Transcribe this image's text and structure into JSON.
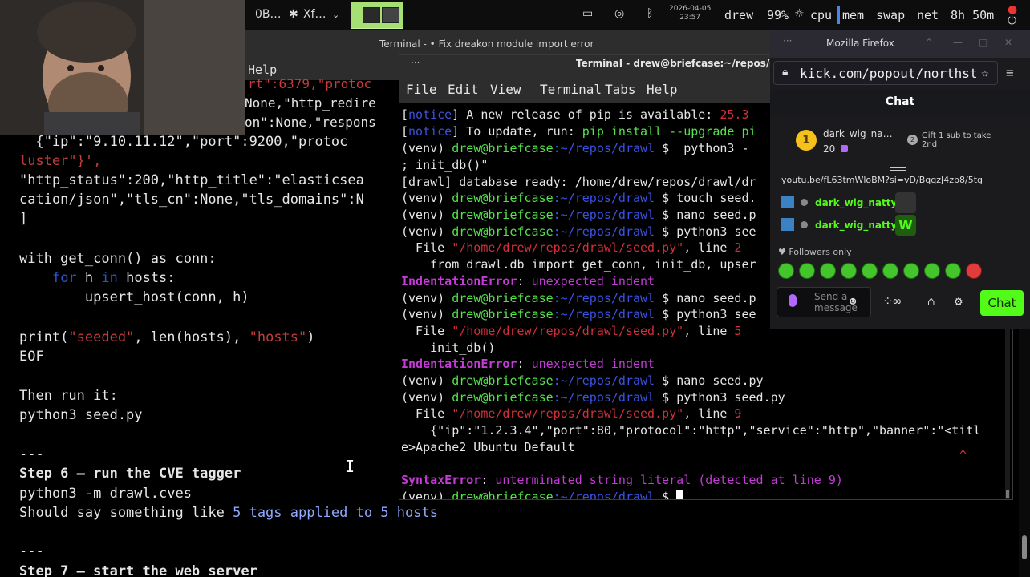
{
  "top_panel": {
    "ws1": "0B…",
    "ws2": "Xf…",
    "clock_date": "2026-04-05",
    "clock_time": "23:57",
    "user": "drew",
    "battery": "99%",
    "cpu": "cpu",
    "mem": "mem",
    "swap": "swap",
    "net": "net",
    "uptime": "8h 50m"
  },
  "bg_terminal": {
    "title": "Terminal - • Fix dreakon module import error",
    "menu_help": "Help"
  },
  "left_text": {
    "l1a": "rt\":6379,\"protoc",
    "l1b": "None,\"http_redire",
    "l2": "on\":None,\"respons",
    "l3a": "  {\"ip\":\"9.10.11.12\",\"port\":9200,\"protoc",
    "l4": "luster\"}',",
    "l5a": "\"http_status\":200,\"http_title\":\"elasticsea",
    "l6a": "cation/json\",\"tls_cn\":None,\"tls_domains\":N",
    "l7": "]",
    "l8": "with get_conn() as conn:",
    "l9a": "    ",
    "l9b": "for",
    "l9c": " h ",
    "l9d": "in",
    "l9e": " hosts:",
    "l10": "        upsert_host(conn, h)",
    "l11a": "print(",
    "l11b": "\"seeded\"",
    "l11c": ", len(hosts), ",
    "l11d": "\"hosts\"",
    "l11e": ")",
    "l12": "EOF",
    "l13": "Then run it:",
    "l14": "python3 seed.py",
    "l15": "---",
    "l16": "Step 6 — run the CVE tagger",
    "l17": "python3 -m drawl.cves",
    "l18a": "Should say something like ",
    "l18b": "5 tags applied to 5 hosts",
    "l19": "---",
    "l20": "Step 7 — start the web server"
  },
  "terminal": {
    "title": "Terminal - drew@briefcase:~/repos/drawl",
    "menu": [
      "File",
      "Edit",
      "View",
      "Terminal",
      "Tabs",
      "Help"
    ],
    "prompt_user": "drew@briefcase",
    "prompt_path": ":~/repos/drawl",
    "venv": "(venv)",
    "lines": {
      "t1a": "notice",
      "t1b": "] A new release of pip is available: ",
      "t1c": "25.3",
      "t2b": "] To update, run: ",
      "t2c": "pip install --upgrade pi",
      "t3cmd": "python3 -",
      "t4": "; init_db()\"",
      "t5": "[drawl] database ready: /home/drew/repos/drawl/dr",
      "t6cmd": "touch seed.",
      "t7cmd": "nano seed.p",
      "t8cmd": "python3 see",
      "t9a": "  File ",
      "t9b": "\"/home/drew/repos/drawl/seed.py\"",
      "t9c": ", line ",
      "t9d": "2",
      "t10": "    from drawl.db import get_conn, init_db, upser",
      "t11a": "IndentationError",
      "t11b": ": ",
      "t11c": "unexpected indent",
      "t12cmd": "nano seed.p",
      "t13cmd": "python3 see",
      "t14d": "5",
      "t15": "    init_db()",
      "t17cmd": "nano seed.py",
      "t18cmd": "python3 seed.py",
      "t19d": "9",
      "t20": "    {\"ip\":\"1.2.3.4\",\"port\":80,\"protocol\":\"http\",\"service\":\"http\",\"banner\":\"<titl",
      "t21": "e>Apache2 Ubuntu Default",
      "t22caret": "^",
      "t23a": "SyntaxError",
      "t23c": "unterminated string literal (detected at line 9)",
      "dollar": "$"
    }
  },
  "firefox": {
    "title": "Mozilla Firefox",
    "url": "kick.com/popout/northst",
    "chat_header": "Chat",
    "gifter_name": "dark_wig_na…",
    "gifter_count": "20",
    "gift_text": "Gift 1 sub to take 2nd",
    "link_text": "youtu.be/fL63tmWloBM?si=vD/BqqzJ4zp8/5tg",
    "msg_user_1": "dark_wig_natty:",
    "msg_user_2": "dark_wig_natty:",
    "followers_only": "Followers only",
    "send_placeholder": "Send a message",
    "chat_button": "Chat",
    "accent": "#53fc18"
  }
}
